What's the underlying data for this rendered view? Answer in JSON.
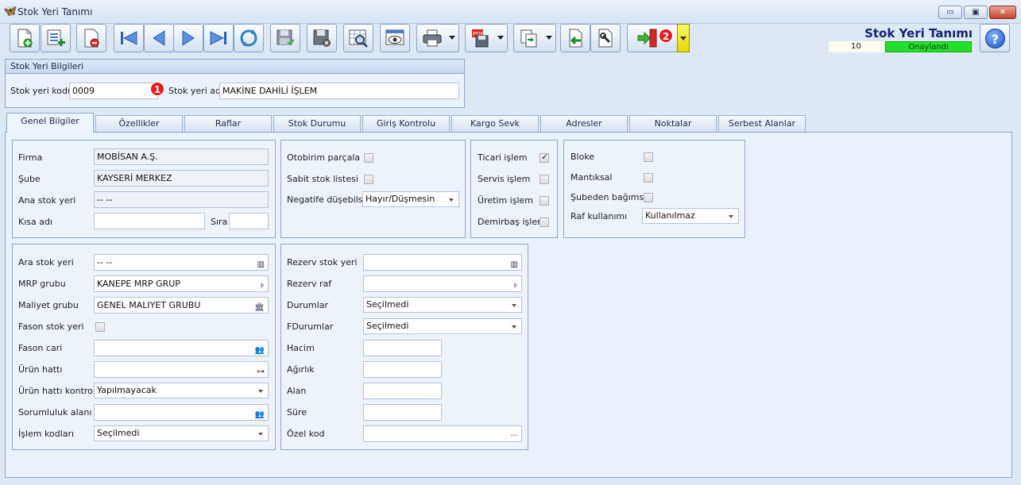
{
  "window": {
    "title": "Stok Yeri Tanımı",
    "minimize": "▭",
    "maximize": "▣",
    "close": "✕"
  },
  "header": {
    "title": "Stok Yeri Tanımı",
    "number": "10",
    "status": "Onaylandı",
    "badge1": "1",
    "badge2": "2",
    "help": "?"
  },
  "top_group": {
    "title": "Stok Yeri Bilgileri",
    "code_label": "Stok yeri kodu",
    "code_value": "0009",
    "name_label": "Stok yeri adı",
    "name_value": "MAKİNE DAHİLİ İŞLEM"
  },
  "tabs": [
    "Genel Bilgiler",
    "Özellikler",
    "Raflar",
    "Stok Durumu",
    "Giriş Kontrolu",
    "Kargo Sevk",
    "Adresler",
    "Noktalar",
    "Serbest Alanlar"
  ],
  "general": {
    "firma_label": "Firma",
    "firma_value": "MOBİSAN A.Ş.",
    "sube_label": "Şube",
    "sube_value": "KAYSERİ MERKEZ",
    "ana_label": "Ana stok yeri",
    "ana_value": "-- --",
    "kisa_label": "Kısa adı",
    "kisa_value": "",
    "sira_label": "Sıra",
    "sira_value": ""
  },
  "panel2": {
    "otobirim": "Otobirim parçala",
    "sabit": "Sabit stok listesi",
    "negatif_label": "Negatife düşebilsin",
    "negatif_value": "Hayır/Düşmesin"
  },
  "panel3": {
    "ticari": "Ticari işlem",
    "servis": "Servis işlem",
    "uretim": "Üretim işlem",
    "demirbas": "Demirbaş işlem"
  },
  "panel4": {
    "bloke": "Bloke",
    "mantiksal": "Mantıksal",
    "subeden": "Şubeden bağımsız",
    "raf_label": "Raf kullanımı",
    "raf_value": "Kullanılmaz"
  },
  "panel5": {
    "ara_label": "Ara stok yeri",
    "ara_value": "-- --",
    "mrp_label": "MRP grubu",
    "mrp_value": "KANEPE MRP GRUP",
    "maliyet_label": "Maliyet grubu",
    "maliyet_value": "GENEL MALIYET GRUBU",
    "fason_stok_label": "Fason stok yeri",
    "fason_cari_label": "Fason cari",
    "fason_cari_value": "",
    "urun_hatti_label": "Ürün hattı",
    "urun_hatti_value": "",
    "urun_kontrol_label": "Ürün hattı kontrolü",
    "urun_kontrol_value": "Yapılmayacak",
    "sorumluluk_label": "Sorumluluk alanı",
    "sorumluluk_value": "",
    "islem_label": "İşlem kodları",
    "islem_value": "Seçilmedi"
  },
  "panel6": {
    "rezerv_stok_label": "Rezerv stok yeri",
    "rezerv_stok_value": "",
    "rezerv_raf_label": "Rezerv raf",
    "rezerv_raf_value": "",
    "durumlar_label": "Durumlar",
    "durumlar_value": "Seçilmedi",
    "fdurumlar_label": "FDurumlar",
    "fdurumlar_value": "Seçilmedi",
    "hacim_label": "Hacim",
    "agirlik_label": "Ağırlık",
    "alan_label": "Alan",
    "sure_label": "Süre",
    "ozel_label": "Özel kod",
    "ozel_dots": "···"
  }
}
